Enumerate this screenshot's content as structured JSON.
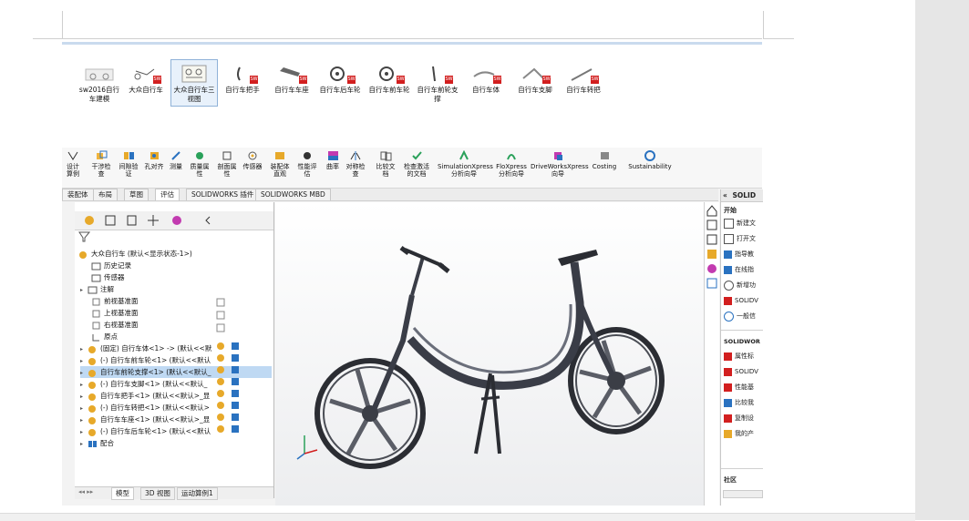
{
  "file_browser": {
    "items": [
      {
        "label": "sw2016自行车建模"
      },
      {
        "label": "大众自行车"
      },
      {
        "label": "大众自行车三视图"
      },
      {
        "label": "自行车把手"
      },
      {
        "label": "自行车车座"
      },
      {
        "label": "自行车后车轮"
      },
      {
        "label": "自行车前车轮"
      },
      {
        "label": "自行车前轮支撑"
      },
      {
        "label": "自行车体"
      },
      {
        "label": "自行车支脚"
      },
      {
        "label": "自行车转把"
      }
    ]
  },
  "commands": [
    {
      "label": "设计算例"
    },
    {
      "label": "干涉检查"
    },
    {
      "label": "间隙验证"
    },
    {
      "label": "孔对齐"
    },
    {
      "label": "测量"
    },
    {
      "label": "质量属性"
    },
    {
      "label": "剖面属性"
    },
    {
      "label": "传感器"
    },
    {
      "label": "装配体直观"
    },
    {
      "label": "性能评估"
    },
    {
      "label": "曲率"
    },
    {
      "label": "对称检查"
    },
    {
      "label": "比较文档"
    },
    {
      "label": "检查激活的文档"
    },
    {
      "label": "SimulationXpress 分析向导"
    },
    {
      "label": "FloXpress 分析向导"
    },
    {
      "label": "DriveWorksXpress 向导"
    },
    {
      "label": "Costing"
    },
    {
      "label": "Sustainability"
    }
  ],
  "tabs": [
    {
      "label": "装配体"
    },
    {
      "label": "布局"
    },
    {
      "label": "草图"
    },
    {
      "label": "评估"
    },
    {
      "label": "SOLIDWORKS 插件"
    },
    {
      "label": "SOLIDWORKS MBD"
    }
  ],
  "tree": {
    "root": "大众自行车  (默认<显示状态-1>)",
    "items": [
      {
        "label": "历史记录"
      },
      {
        "label": "传感器"
      },
      {
        "label": "注解"
      },
      {
        "label": "前视基准面"
      },
      {
        "label": "上视基准面"
      },
      {
        "label": "右视基准面"
      },
      {
        "label": "原点"
      },
      {
        "label": "(固定) 自行车体<1> -> (默认<<默"
      },
      {
        "label": "(-) 自行车前车轮<1> (默认<<默认"
      },
      {
        "label": "自行车前轮支撑<1> (默认<<默认_"
      },
      {
        "label": "(-) 自行车支脚<1> (默认<<默认_"
      },
      {
        "label": "自行车把手<1> (默认<<默认>_显"
      },
      {
        "label": "(-) 自行车转把<1> (默认<<默认>"
      },
      {
        "label": "自行车车座<1> (默认<<默认>_显"
      },
      {
        "label": "(-) 自行车后车轮<1> (默认<<默认"
      },
      {
        "label": "配合"
      }
    ],
    "bottom_tabs": [
      {
        "label": "模型"
      },
      {
        "label": "3D 视图"
      },
      {
        "label": "运动算例1"
      }
    ]
  },
  "taskpane": {
    "header": "SOLID",
    "section1_title": "开始",
    "section1_items": [
      {
        "label": "新建文"
      },
      {
        "label": "打开文"
      },
      {
        "label": "指导教"
      },
      {
        "label": "在线指"
      },
      {
        "label": "新增功"
      },
      {
        "label": "SOLIDV"
      },
      {
        "label": "一般信"
      }
    ],
    "section2_title": "SOLIDWOR",
    "section2_items": [
      {
        "label": "属性标"
      },
      {
        "label": "SOLIDV"
      },
      {
        "label": "性能基"
      },
      {
        "label": "比较我"
      },
      {
        "label": "复制设"
      },
      {
        "label": "我的产"
      }
    ],
    "section3_title": "社区",
    "collapse_glyph": "«"
  },
  "colors": {
    "accent_blue": "#2a72c0",
    "selection": "#bfd9f3",
    "sw_red": "#d21f1f"
  }
}
